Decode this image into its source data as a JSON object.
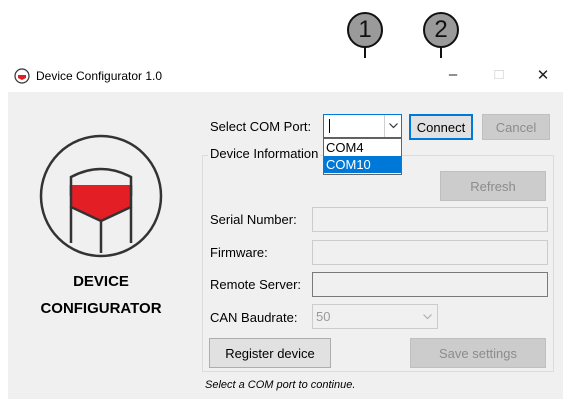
{
  "callouts": [
    "1",
    "2"
  ],
  "window": {
    "title": "Device Configurator 1.0",
    "controls": {
      "minimize": "–",
      "maximize": "□",
      "close": "✕"
    }
  },
  "brand": {
    "line1": "DEVICE",
    "line2": "CONFIGURATOR"
  },
  "com_port": {
    "label": "Select COM Port:",
    "value": "",
    "options": [
      "COM4",
      "COM10"
    ],
    "highlighted": "COM10",
    "connect_label": "Connect",
    "cancel_label": "Cancel"
  },
  "device_info": {
    "group_title": "Device Information",
    "refresh_label": "Refresh",
    "serial_number_label": "Serial Number:",
    "firmware_label": "Firmware:",
    "remote_server_label": "Remote Server:",
    "can_baudrate_label": "CAN Baudrate:",
    "can_baudrate_value": "50",
    "register_label": "Register device",
    "save_label": "Save settings"
  },
  "status_text": "Select a COM port to continue.",
  "colors": {
    "accent": "#0078d7",
    "logo_red": "#e31e24",
    "callout_fill": "#9a9a9a"
  }
}
